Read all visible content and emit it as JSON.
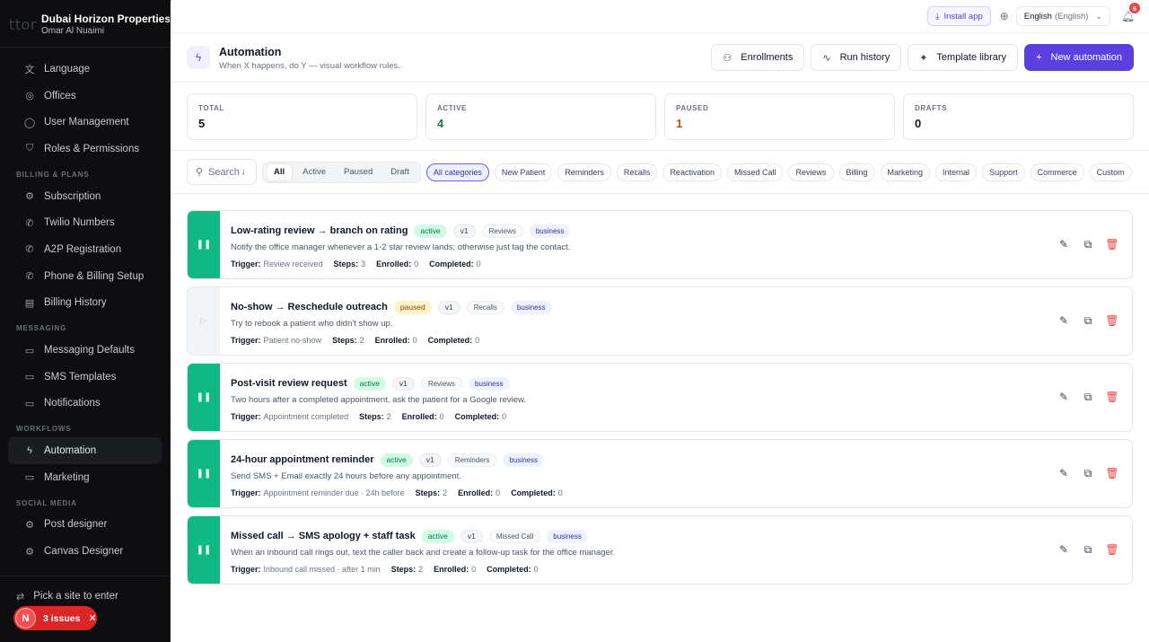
{
  "sidebar": {
    "logo_text": "ttor",
    "company": "Dubai Horizon Properties",
    "user": "Omar Al Nuaimi",
    "items_top": [
      {
        "label": "Language",
        "icon": "translate-icon"
      },
      {
        "label": "Offices",
        "icon": "location-pin-icon"
      },
      {
        "label": "User Management",
        "icon": "user-icon"
      },
      {
        "label": "Roles & Permissions",
        "icon": "shield-icon"
      }
    ],
    "section_billing": "BILLING & PLANS",
    "items_billing": [
      {
        "label": "Subscription",
        "icon": "gear-icon"
      },
      {
        "label": "Twilio Numbers",
        "icon": "phone-icon"
      },
      {
        "label": "A2P Registration",
        "icon": "phone-icon"
      },
      {
        "label": "Phone & Billing Setup",
        "icon": "phone-icon"
      },
      {
        "label": "Billing History",
        "icon": "receipt-icon"
      }
    ],
    "section_messaging": "MESSAGING",
    "items_messaging": [
      {
        "label": "Messaging Defaults",
        "icon": "message-icon"
      },
      {
        "label": "SMS Templates",
        "icon": "message-icon"
      },
      {
        "label": "Notifications",
        "icon": "message-icon"
      }
    ],
    "section_workflows": "WORKFLOWS",
    "items_workflows": [
      {
        "label": "Automation",
        "icon": "bolt-icon"
      },
      {
        "label": "Marketing",
        "icon": "message-icon"
      }
    ],
    "section_social": "SOCIAL MEDIA",
    "items_social": [
      {
        "label": "Post designer",
        "icon": "gear-icon"
      },
      {
        "label": "Canvas Designer",
        "icon": "gear-icon"
      }
    ],
    "pick_site": "Pick a site to enter",
    "issues": {
      "avatar": "N",
      "label": "3 issues"
    }
  },
  "topbar": {
    "install": "Install app",
    "language": "English",
    "language_sub": "(English)",
    "notifications_count": "6"
  },
  "header": {
    "title": "Automation",
    "subtitle": "When X happens, do Y — visual workflow rules.",
    "actions": {
      "enrollments": "Enrollments",
      "run_history": "Run history",
      "template_library": "Template library",
      "new_automation": "New automation"
    }
  },
  "stats": [
    {
      "label": "TOTAL",
      "value": "5"
    },
    {
      "label": "ACTIVE",
      "value": "4"
    },
    {
      "label": "PAUSED",
      "value": "1"
    },
    {
      "label": "DRAFTS",
      "value": "0"
    }
  ],
  "filters": {
    "search_placeholder": "Search a",
    "status": [
      "All",
      "Active",
      "Paused",
      "Draft"
    ],
    "categories": [
      "All categories",
      "New Patient",
      "Reminders",
      "Recalls",
      "Reactivation",
      "Missed Call",
      "Reviews",
      "Billing",
      "Marketing",
      "Internal",
      "Support",
      "Commerce",
      "Custom"
    ]
  },
  "labels": {
    "trigger": "Trigger:",
    "steps": "Steps:",
    "enrolled": "Enrolled:",
    "completed": "Completed:"
  },
  "automations": [
    {
      "title": "Low-rating review → branch on rating",
      "status": "active",
      "version": "v1",
      "category": "Reviews",
      "scope": "business",
      "description": "Notify the office manager whenever a 1-2 star review lands; otherwise just tag the contact.",
      "trigger": "Review received",
      "steps": "3",
      "enrolled": "0",
      "completed": "0"
    },
    {
      "title": "No-show → Reschedule outreach",
      "status": "paused",
      "version": "v1",
      "category": "Recalls",
      "scope": "business",
      "description": "Try to rebook a patient who didn't show up.",
      "trigger": "Patient no-show",
      "steps": "2",
      "enrolled": "0",
      "completed": "0"
    },
    {
      "title": "Post-visit review request",
      "status": "active",
      "version": "v1",
      "category": "Reviews",
      "scope": "business",
      "description": "Two hours after a completed appointment, ask the patient for a Google review.",
      "trigger": "Appointment completed",
      "steps": "2",
      "enrolled": "0",
      "completed": "0"
    },
    {
      "title": "24-hour appointment reminder",
      "status": "active",
      "version": "v1",
      "category": "Reminders",
      "scope": "business",
      "description": "Send SMS + Email exactly 24 hours before any appointment.",
      "trigger": "Appointment reminder due · 24h before",
      "steps": "2",
      "enrolled": "0",
      "completed": "0"
    },
    {
      "title": "Missed call → SMS apology + staff task",
      "status": "active",
      "version": "v1",
      "category": "Missed Call",
      "scope": "business",
      "description": "When an inbound call rings out, text the caller back and create a follow-up task for the office manager.",
      "trigger": "Inbound call missed · after 1 min",
      "steps": "2",
      "enrolled": "0",
      "completed": "0"
    }
  ]
}
